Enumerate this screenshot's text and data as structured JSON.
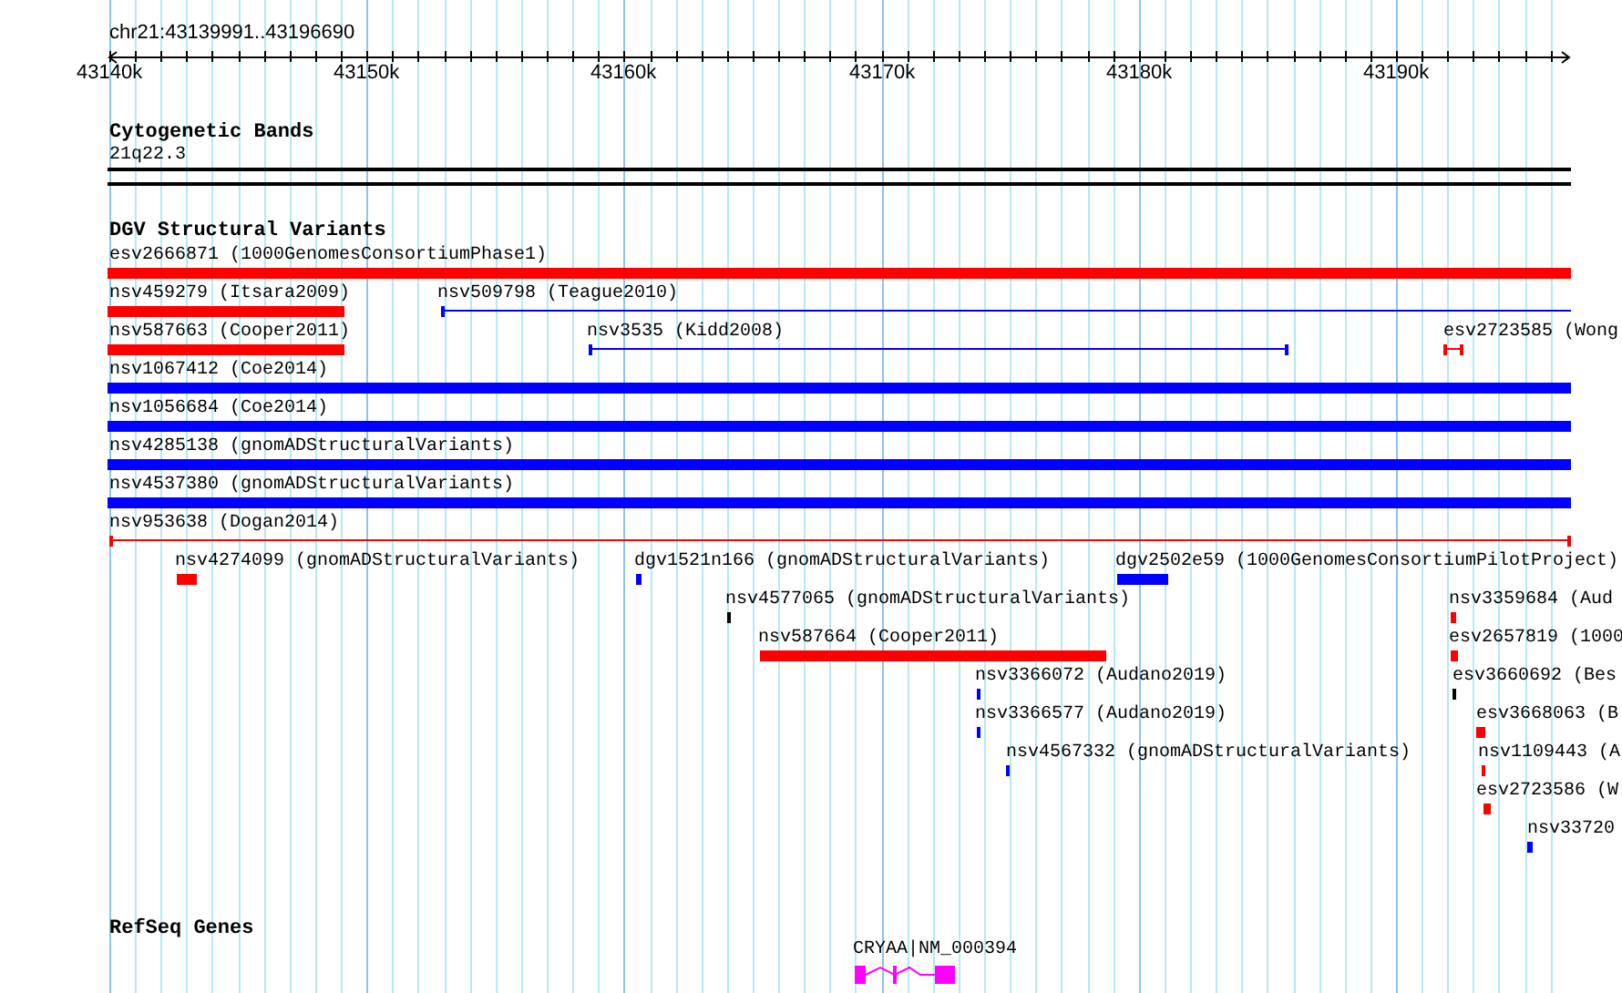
{
  "ruler": {
    "location": "chr21:43139991..43196690",
    "ticks": [
      "43140k",
      "43150k",
      "43160k",
      "43170k",
      "43180k",
      "43190k"
    ]
  },
  "tracks": [
    {
      "title": "Cytogenetic Bands",
      "kind": "bands",
      "features": [
        {
          "label": "21q22.3"
        }
      ]
    },
    {
      "title": "DGV Structural Variants",
      "kind": "variants",
      "features": [
        {
          "label": "esv2666871 (1000GenomesConsortiumPhase1)",
          "kind": "bar",
          "color": "#ff0000"
        },
        {
          "label": "nsv459279 (Itsara2009)",
          "kind": "bar",
          "color": "#ff0000"
        },
        {
          "label": "nsv509798 (Teague2010)",
          "kind": "span",
          "color": "#0000ff"
        },
        {
          "label": "nsv587663 (Cooper2011)",
          "kind": "bar",
          "color": "#ff0000"
        },
        {
          "label": "nsv3535 (Kidd2008)",
          "kind": "span",
          "color": "#0000ff"
        },
        {
          "label": "esv2723585 (Wong",
          "kind": "span",
          "color": "#ff0000"
        },
        {
          "label": "nsv1067412 (Coe2014)",
          "kind": "bar",
          "color": "#0000ff"
        },
        {
          "label": "nsv1056684 (Coe2014)",
          "kind": "bar",
          "color": "#0000ff"
        },
        {
          "label": "nsv4285138 (gnomADStructuralVariants)",
          "kind": "bar",
          "color": "#0000ff"
        },
        {
          "label": "nsv4537380 (gnomADStructuralVariants)",
          "kind": "bar",
          "color": "#0000ff"
        },
        {
          "label": "nsv953638 (Dogan2014)",
          "kind": "span",
          "color": "#ff0000"
        },
        {
          "label": "nsv4274099 (gnomADStructuralVariants)",
          "kind": "bar",
          "color": "#ff0000"
        },
        {
          "label": "dgv1521n166 (gnomADStructuralVariants)",
          "kind": "bar",
          "color": "#0000ff"
        },
        {
          "label": "dgv2502e59 (1000GenomesConsortiumPilotProject)",
          "kind": "bar",
          "color": "#0000ff"
        },
        {
          "label": "nsv4577065 (gnomADStructuralVariants)",
          "kind": "bar",
          "color": "#000000"
        },
        {
          "label": "nsv3359684 (Aud",
          "kind": "bar",
          "color": "#ff0000"
        },
        {
          "label": "nsv587664 (Cooper2011)",
          "kind": "bar",
          "color": "#ff0000"
        },
        {
          "label": "esv2657819 (1000",
          "kind": "bar",
          "color": "#ff0000"
        },
        {
          "label": "nsv3366072 (Audano2019)",
          "kind": "bar",
          "color": "#0000ff"
        },
        {
          "label": "esv3660692 (Bes",
          "kind": "bar",
          "color": "#000000"
        },
        {
          "label": "nsv3366577 (Audano2019)",
          "kind": "bar",
          "color": "#0000ff"
        },
        {
          "label": "esv3668063 (B",
          "kind": "bar",
          "color": "#ff0000"
        },
        {
          "label": "nsv4567332 (gnomADStructuralVariants)",
          "kind": "bar",
          "color": "#0000ff"
        },
        {
          "label": "nsv1109443 (A",
          "kind": "bar",
          "color": "#ff0000"
        },
        {
          "label": "esv2723586 (W",
          "kind": "span",
          "color": "#ff0000"
        },
        {
          "label": "nsv33720",
          "kind": "bar",
          "color": "#0000ff"
        }
      ]
    },
    {
      "title": "RefSeq Genes",
      "kind": "genes",
      "features": [
        {
          "label": "CRYAA|NM_000394",
          "color": "#ff00ff"
        }
      ]
    }
  ]
}
